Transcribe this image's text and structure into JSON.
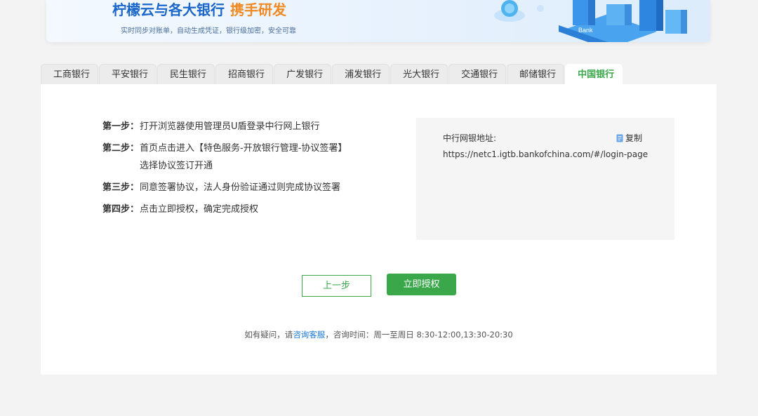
{
  "banner": {
    "title_main": "柠檬云与各大银行",
    "title_accent": "携手研发",
    "subtitle": "实时同步对账单，自动生成凭证，银行级加密，安全可靠",
    "art_text": "Bank",
    "colors": {
      "main": "#1a66c9",
      "accent": "#f08a24"
    }
  },
  "tabs": [
    {
      "label": "工商银行",
      "active": false
    },
    {
      "label": "平安银行",
      "active": false
    },
    {
      "label": "民生银行",
      "active": false
    },
    {
      "label": "招商银行",
      "active": false
    },
    {
      "label": "广发银行",
      "active": false
    },
    {
      "label": "浦发银行",
      "active": false
    },
    {
      "label": "光大银行",
      "active": false
    },
    {
      "label": "交通银行",
      "active": false
    },
    {
      "label": "邮储银行",
      "active": false
    },
    {
      "label": "中国银行",
      "active": true
    }
  ],
  "steps": [
    {
      "label": "第一步：",
      "text": "打开浏览器使用管理员U盾登录中行网上银行",
      "text2": ""
    },
    {
      "label": "第二步：",
      "text": "首页点击进入【特色服务-开放银行管理-协议签署】",
      "text2": "选择协议签订开通"
    },
    {
      "label": "第三步：",
      "text": "同意签署协议，法人身份验证通过则完成协议签署",
      "text2": ""
    },
    {
      "label": "第四步：",
      "text": "点击立即授权，确定完成授权",
      "text2": ""
    }
  ],
  "url_box": {
    "label": "中行网银地址:",
    "copy_label": "复制",
    "url": "https://netc1.igtb.bankofchina.com/#/login-page"
  },
  "buttons": {
    "prev": "上一步",
    "authorize": "立即授权"
  },
  "help": {
    "prefix": "如有疑问，请",
    "link": "咨询客服",
    "suffix": "，咨询时间：周一至周日 8:30-12:00,13:30-20:30"
  },
  "colors": {
    "accent_green": "#3aa84a",
    "link_blue": "#1a7ad9",
    "page_bg": "#f3f3f3"
  }
}
